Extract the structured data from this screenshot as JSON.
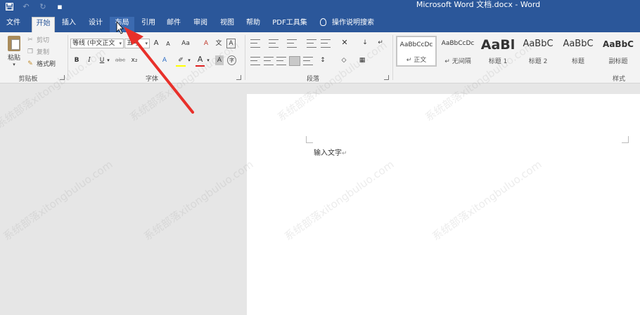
{
  "window": {
    "title": "Microsoft Word 文档.docx  -  Word"
  },
  "tabs": [
    {
      "label": "文件",
      "state": "normal"
    },
    {
      "label": "开始",
      "state": "active"
    },
    {
      "label": "插入",
      "state": "normal"
    },
    {
      "label": "设计",
      "state": "normal"
    },
    {
      "label": "布局",
      "state": "hover"
    },
    {
      "label": "引用",
      "state": "normal"
    },
    {
      "label": "邮件",
      "state": "normal"
    },
    {
      "label": "审阅",
      "state": "normal"
    },
    {
      "label": "视图",
      "state": "normal"
    },
    {
      "label": "帮助",
      "state": "normal"
    },
    {
      "label": "PDF工具集",
      "state": "normal"
    },
    {
      "label": "操作说明搜索",
      "state": "normal"
    }
  ],
  "clipboard": {
    "paste": "粘贴",
    "cut": "剪切",
    "copy": "复制",
    "format_painter": "格式刷",
    "group": "剪贴板"
  },
  "font": {
    "name": "等线 (中文正文",
    "size": "五号",
    "bold": "B",
    "italic": "I",
    "underline": "U",
    "strike": "abc",
    "subscript": "x₂",
    "grow": "A",
    "shrink": "A",
    "case": "Aa",
    "clear": "A",
    "phonetic": "文",
    "border": "A",
    "font_color": "A",
    "charshade": "A",
    "circle": "字",
    "group": "字体"
  },
  "paragraph": {
    "group": "段落"
  },
  "styles": {
    "group": "样式",
    "items": [
      {
        "sample": "AaBbCcDc",
        "name": "↵ 正文"
      },
      {
        "sample": "AaBbCcDc",
        "name": "↵ 无间隔"
      },
      {
        "sample": "AaBl",
        "name": "标题 1"
      },
      {
        "sample": "AaBbC",
        "name": "标题 2"
      },
      {
        "sample": "AaBbC",
        "name": "标题"
      },
      {
        "sample": "AaBbC",
        "name": "副标题"
      }
    ]
  },
  "document": {
    "text": "输入文字",
    "para_mark": "↵"
  },
  "watermark": {
    "text": "系统部落xitongbuluo.com"
  },
  "colors": {
    "accent": "#2b579a",
    "arrow": "#e8302a",
    "highlight": "#ffff00",
    "font_color_bar": "#e02020"
  }
}
